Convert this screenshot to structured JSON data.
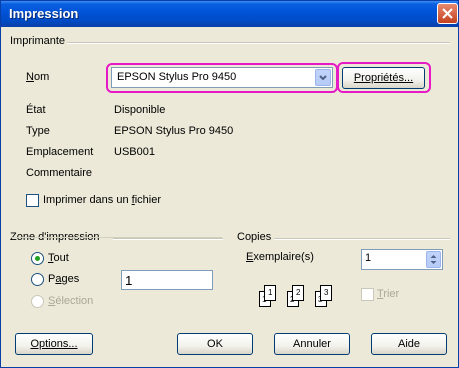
{
  "window": {
    "title": "Impression"
  },
  "printer": {
    "section_label": "Imprimante",
    "name_label": "Nom",
    "name_value": "EPSON Stylus Pro 9450",
    "properties_button": "Propriétés...",
    "status_label": "État",
    "status_value": "Disponible",
    "type_label": "Type",
    "type_value": "EPSON Stylus Pro 9450",
    "location_label": "Emplacement",
    "location_value": "USB001",
    "comment_label": "Commentaire",
    "comment_value": "",
    "print_to_file_label": "Imprimer dans un fichier",
    "print_to_file_checked": false
  },
  "print_range": {
    "section_label": "Zone d'impression",
    "all_label": "Tout",
    "pages_label": "Pages",
    "pages_value": "1",
    "selection_label": "Sélection",
    "selected": "all"
  },
  "copies": {
    "section_label": "Copies",
    "copies_label": "Exemplaire(s)",
    "copies_value": "1",
    "collate_label": "Trier",
    "collate_checked": false,
    "page_numbers": [
      "1",
      "1",
      "2",
      "2",
      "3",
      "3"
    ]
  },
  "buttons": {
    "options": "Options...",
    "ok": "OK",
    "cancel": "Annuler",
    "help": "Aide"
  },
  "colors": {
    "titlebar": "#0052d6",
    "dialog_bg": "#ece9d8",
    "highlight": "#e619c6"
  }
}
